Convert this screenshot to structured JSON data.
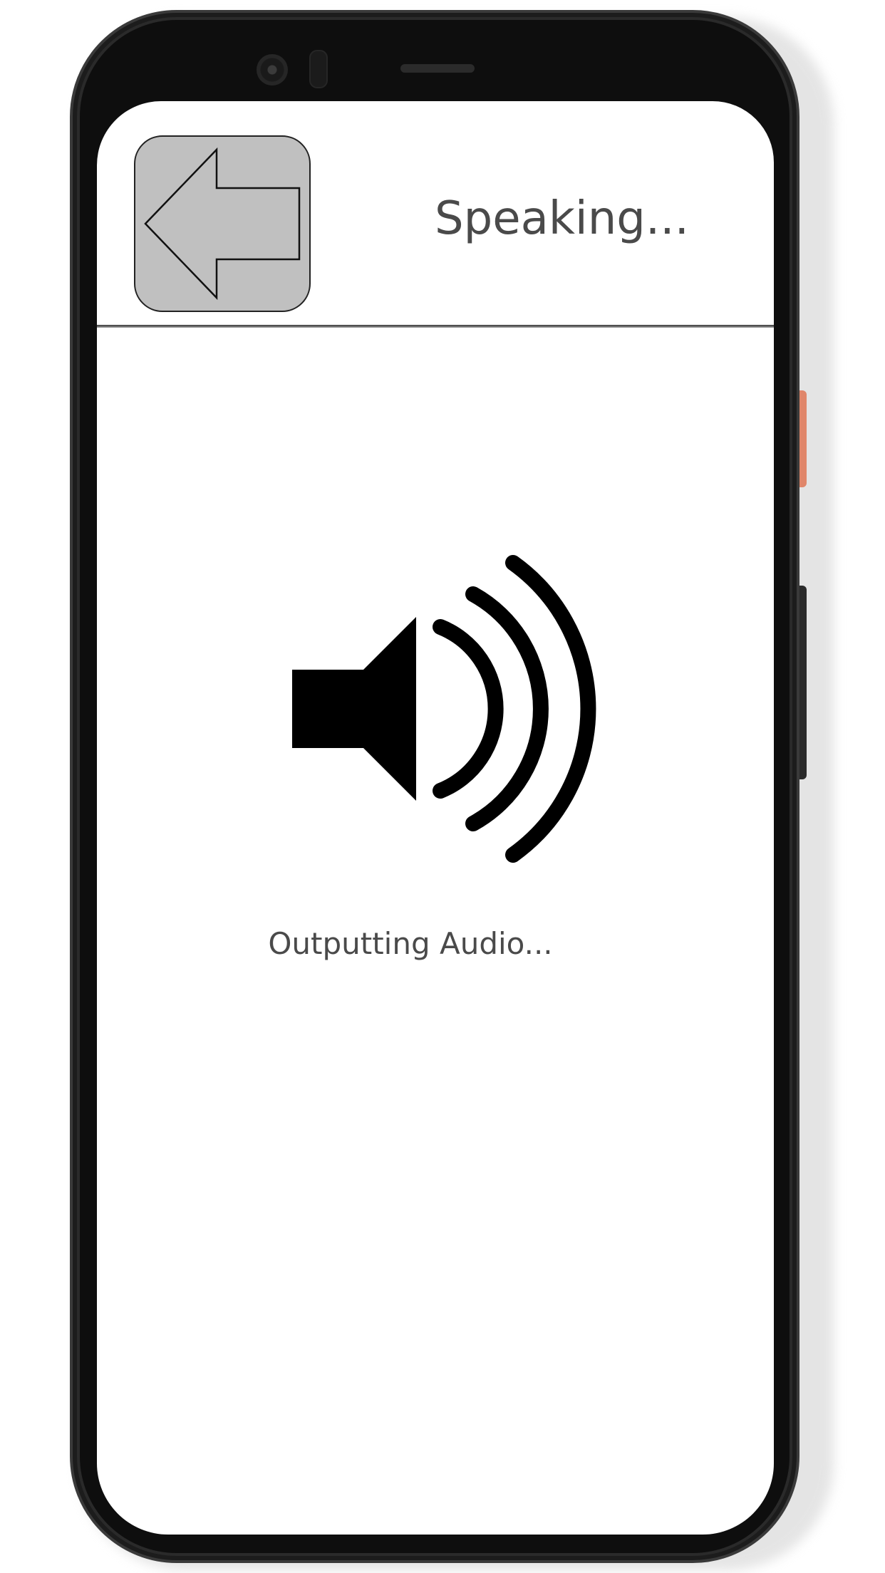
{
  "header": {
    "title": "Speaking...",
    "back_button_icon": "back-arrow-icon"
  },
  "main": {
    "status_icon": "speaker-volume-icon",
    "status_text": "Outputting Audio..."
  },
  "colors": {
    "back_button_fill": "#c0c0c0",
    "text": "#4a4a4a",
    "icon": "#000000",
    "device_frame": "#0e0e0e",
    "device_side_button_accent": "#e0866a"
  }
}
